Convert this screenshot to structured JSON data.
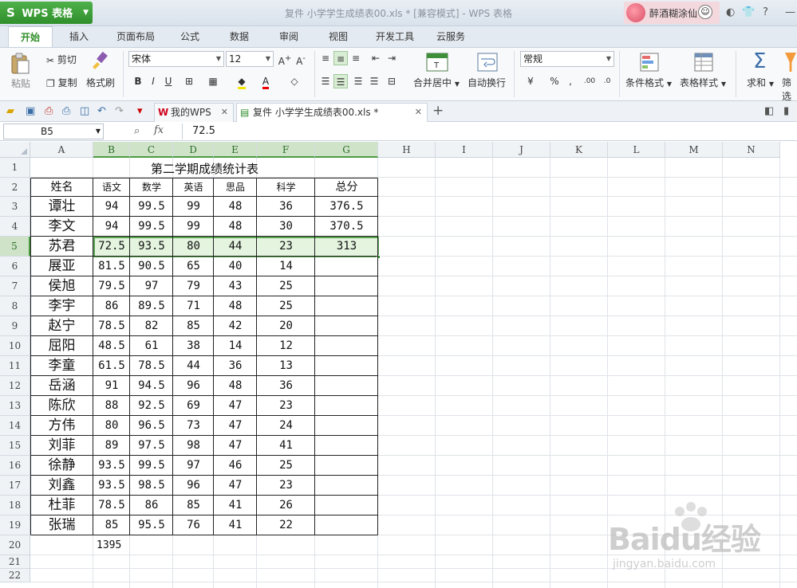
{
  "titlebar": {
    "app_name": "WPS 表格",
    "window_title": "复件 小学学生成绩表00.xls * [兼容模式] - WPS 表格",
    "user_name": "醉酒糊涂仙",
    "help_label": "?"
  },
  "ribbon_tabs": [
    "开始",
    "插入",
    "页面布局",
    "公式",
    "数据",
    "审阅",
    "视图",
    "开发工具",
    "云服务"
  ],
  "ribbon": {
    "paste": "粘贴",
    "cut": "剪切",
    "copy": "复制",
    "format_painter": "格式刷",
    "font_name": "宋体",
    "font_size": "12",
    "bold": "B",
    "italic": "I",
    "underline": "U",
    "merge_center": "合并居中",
    "wrap_text": "自动换行",
    "number_format": "常规",
    "conditional_format": "条件格式",
    "table_style": "表格样式",
    "sum": "求和",
    "filter": "筛选"
  },
  "doc_tabs": {
    "home": "我的WPS",
    "file": "复件 小学学生成绩表00.xls *"
  },
  "formula_bar": {
    "cell_ref": "B5",
    "fx": "fx",
    "value": "72.5"
  },
  "columns": [
    "A",
    "B",
    "C",
    "D",
    "E",
    "F",
    "G",
    "H",
    "I",
    "J",
    "K",
    "L",
    "M",
    "N"
  ],
  "rows": [
    "1",
    "2",
    "3",
    "4",
    "5",
    "6",
    "7",
    "8",
    "9",
    "10",
    "11",
    "12",
    "13",
    "14",
    "15",
    "16",
    "17",
    "18",
    "19",
    "20",
    "21",
    "22"
  ],
  "sheet": {
    "title": "第二学期成绩统计表",
    "headers": [
      "姓名",
      "语文",
      "数学",
      "英语",
      "思品",
      "科学",
      "总分"
    ],
    "students": [
      [
        "谭壮",
        "94",
        "99.5",
        "99",
        "48",
        "36",
        "376.5"
      ],
      [
        "李文",
        "94",
        "99.5",
        "99",
        "48",
        "30",
        "370.5"
      ],
      [
        "苏君",
        "72.5",
        "93.5",
        "80",
        "44",
        "23",
        "313"
      ],
      [
        "展亚",
        "81.5",
        "90.5",
        "65",
        "40",
        "14",
        ""
      ],
      [
        "侯旭",
        "79.5",
        "97",
        "79",
        "43",
        "25",
        ""
      ],
      [
        "李宇",
        "86",
        "89.5",
        "71",
        "48",
        "25",
        ""
      ],
      [
        "赵宁",
        "78.5",
        "82",
        "85",
        "42",
        "20",
        ""
      ],
      [
        "屈阳",
        "48.5",
        "61",
        "38",
        "14",
        "12",
        ""
      ],
      [
        "李童",
        "61.5",
        "78.5",
        "44",
        "36",
        "13",
        ""
      ],
      [
        "岳涵",
        "91",
        "94.5",
        "96",
        "48",
        "36",
        ""
      ],
      [
        "陈欣",
        "88",
        "92.5",
        "69",
        "47",
        "23",
        ""
      ],
      [
        "方伟",
        "80",
        "96.5",
        "73",
        "47",
        "24",
        ""
      ],
      [
        "刘菲",
        "89",
        "97.5",
        "98",
        "47",
        "41",
        ""
      ],
      [
        "徐静",
        "93.5",
        "99.5",
        "97",
        "46",
        "25",
        ""
      ],
      [
        "刘鑫",
        "93.5",
        "98.5",
        "96",
        "47",
        "23",
        ""
      ],
      [
        "杜菲",
        "78.5",
        "86",
        "85",
        "41",
        "26",
        ""
      ],
      [
        "张瑞",
        "85",
        "95.5",
        "76",
        "41",
        "22",
        ""
      ]
    ],
    "b20": "1395"
  },
  "watermark": {
    "brand": "Baidu经验",
    "url": "jingyan.baidu.com"
  }
}
